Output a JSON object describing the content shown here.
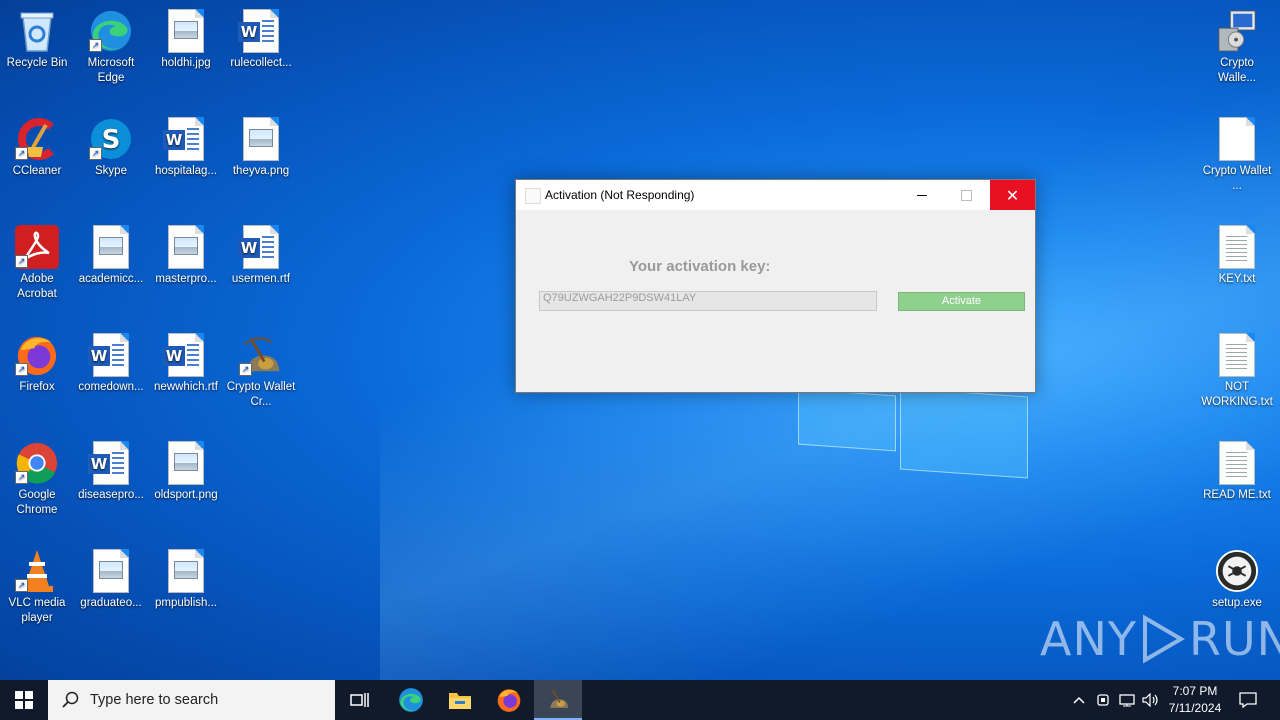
{
  "desktop": {
    "icons": [
      {
        "label": "Recycle Bin"
      },
      {
        "label": "Microsoft Edge"
      },
      {
        "label": "holdhi.jpg"
      },
      {
        "label": "rulecollect..."
      },
      {
        "label": "CCleaner"
      },
      {
        "label": "Skype"
      },
      {
        "label": "hospitalag..."
      },
      {
        "label": "theyva.png"
      },
      {
        "label": "Adobe Acrobat"
      },
      {
        "label": "academicc..."
      },
      {
        "label": "masterpro..."
      },
      {
        "label": "usermen.rtf"
      },
      {
        "label": "Firefox"
      },
      {
        "label": "comedown..."
      },
      {
        "label": "newwhich.rtf"
      },
      {
        "label": "Crypto Wallet Cr..."
      },
      {
        "label": "Google Chrome"
      },
      {
        "label": "diseasepro..."
      },
      {
        "label": "oldsport.png"
      },
      {
        "label": "VLC media player"
      },
      {
        "label": "graduateo..."
      },
      {
        "label": "pmpublish..."
      },
      {
        "label": "Crypto Walle..."
      },
      {
        "label": "Crypto Wallet ..."
      },
      {
        "label": "KEY.txt"
      },
      {
        "label": "NOT WORKING.txt"
      },
      {
        "label": "READ ME.txt"
      },
      {
        "label": "setup.exe"
      }
    ]
  },
  "dialog": {
    "title": "Activation (Not Responding)",
    "key_label": "Your activation key:",
    "key_value": "Q79UZWGAH22P9DSW41LAY",
    "activate_label": "Activate",
    "close_glyph": "✕"
  },
  "watermark": {
    "left": "ANY",
    "right": "RUN"
  },
  "taskbar": {
    "search_placeholder": "Type here to search",
    "apps": [
      "task-view",
      "edge",
      "file-explorer",
      "firefox",
      "crypto-wallet"
    ],
    "time": "7:07 PM",
    "date": "7/11/2024"
  },
  "colors": {
    "close_red": "#e81123",
    "activate_green": "#8fd08f",
    "taskbar": "#111a2a"
  }
}
